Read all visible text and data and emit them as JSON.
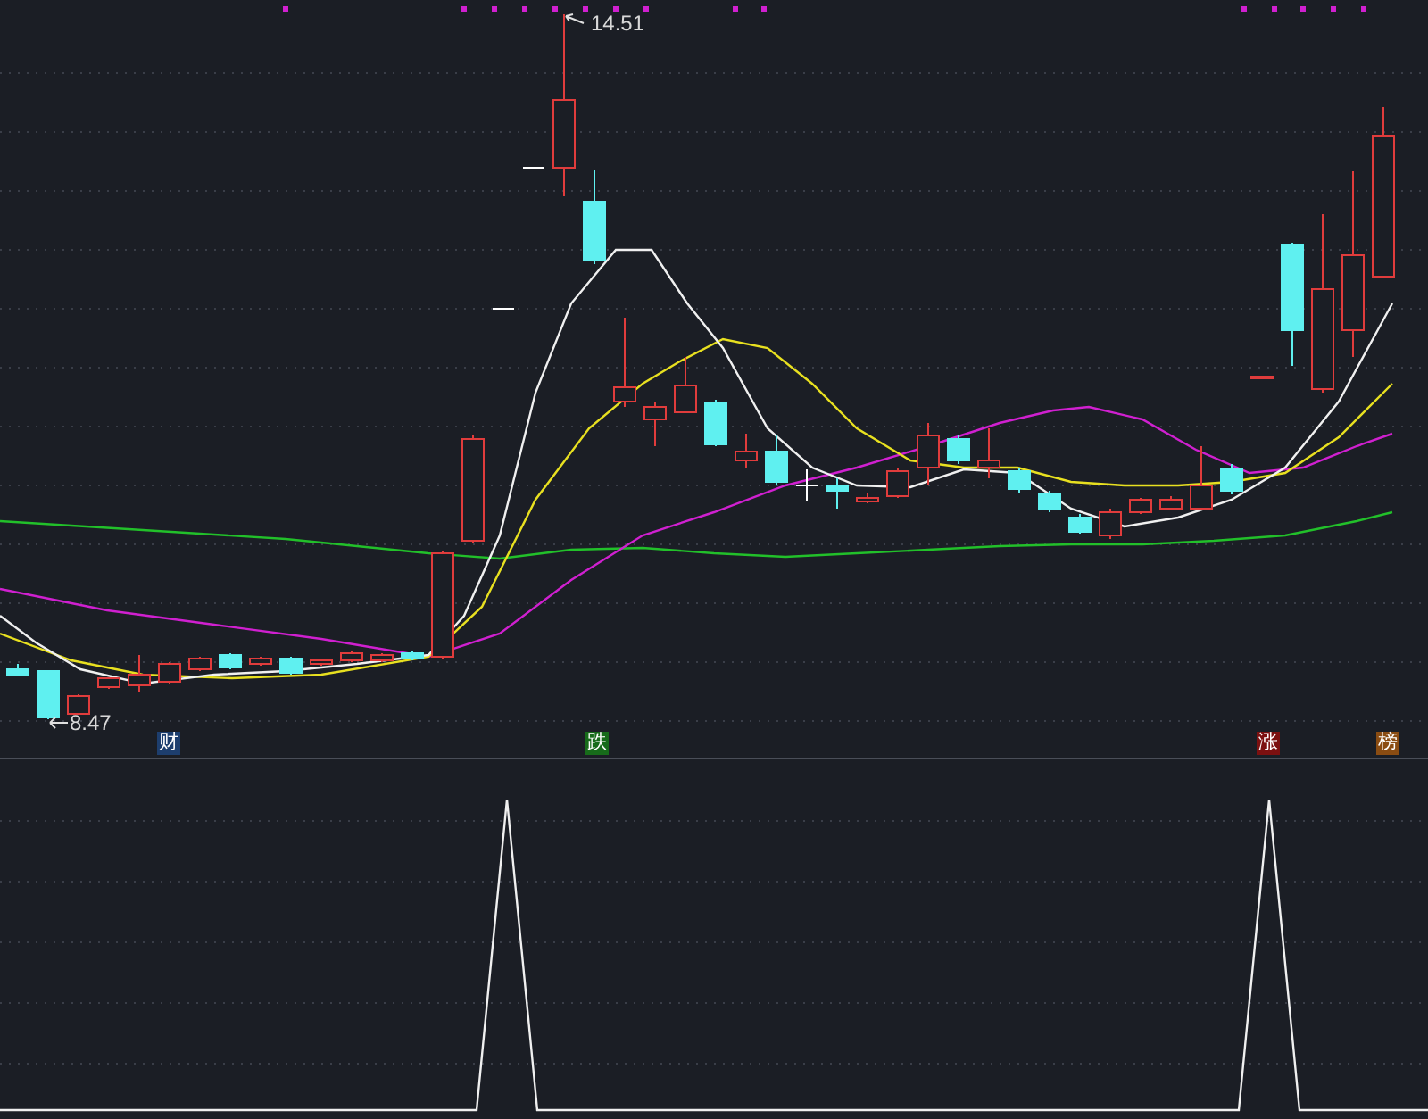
{
  "price_chart": {
    "high_label": "14.51",
    "low_label": "8.47"
  },
  "signals": [
    {
      "text": "财",
      "color": "#1d3e6e"
    },
    {
      "text": "跌",
      "color": "#176b1a"
    },
    {
      "text": "涨",
      "color": "#7c1010"
    },
    {
      "text": "榜",
      "color": "#8a4c12"
    }
  ]
}
